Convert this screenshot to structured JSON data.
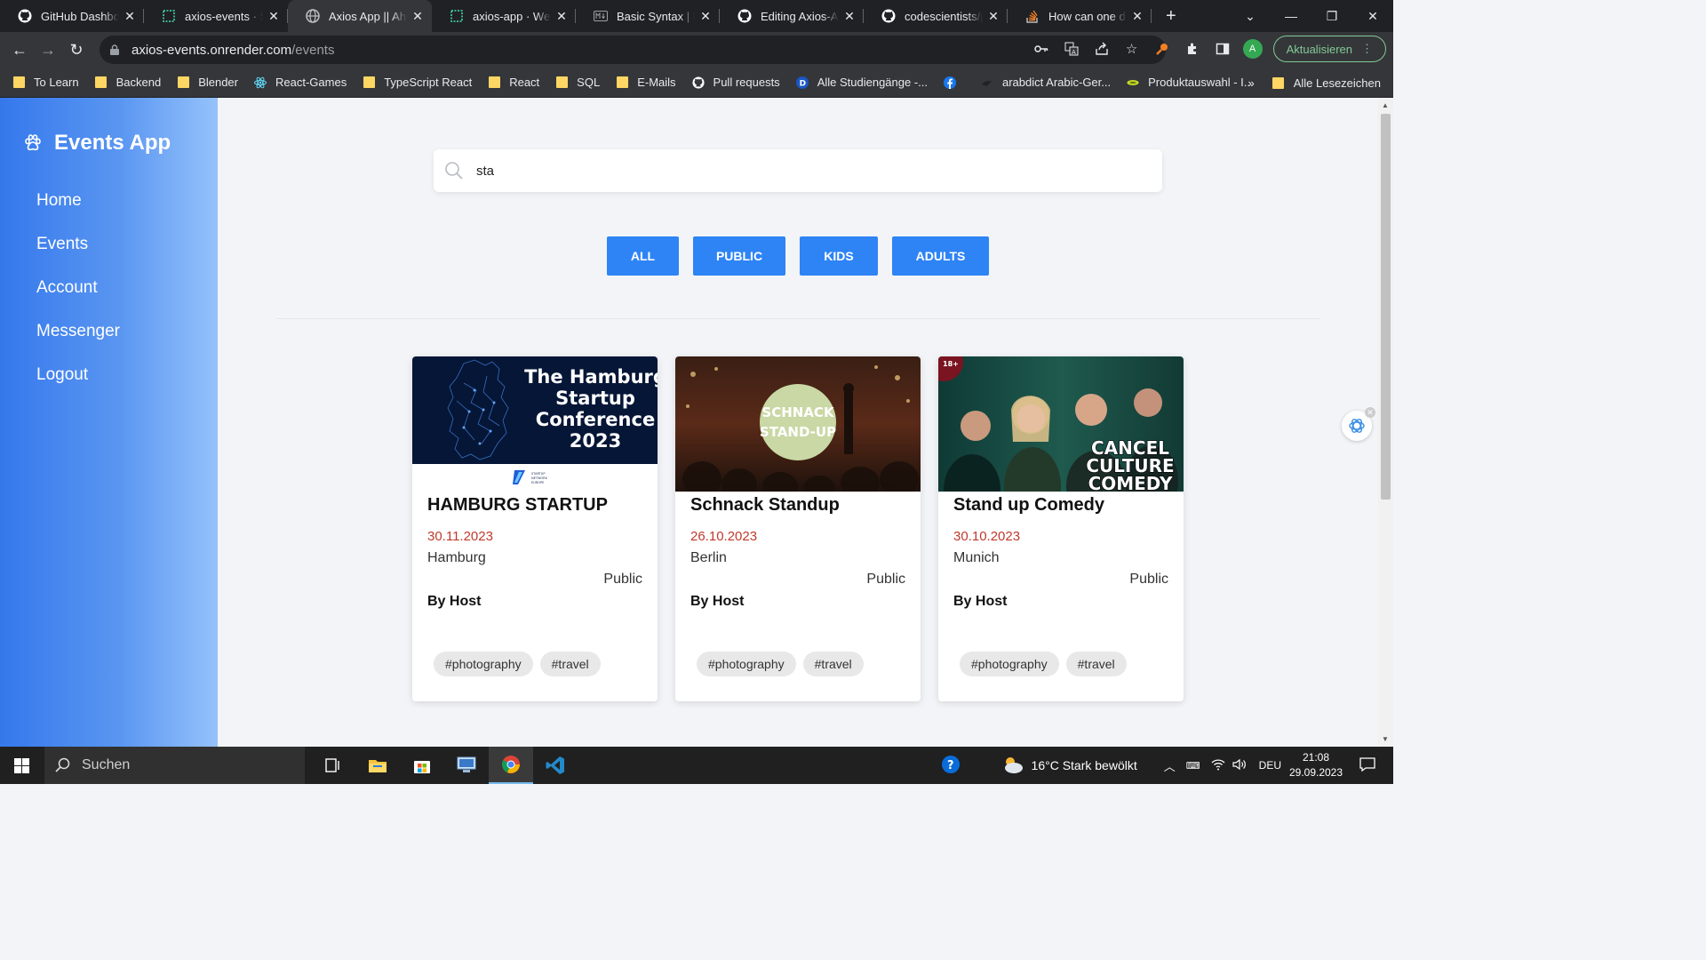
{
  "browser": {
    "tabs": [
      {
        "title": "GitHub Dashboard",
        "icon": "github-icon",
        "active": false
      },
      {
        "title": "axios-events · St",
        "icon": "render-icon",
        "active": false
      },
      {
        "title": "Axios App || Ahm",
        "icon": "globe-icon",
        "active": true
      },
      {
        "title": "axios-app · Web",
        "icon": "render-icon",
        "active": false
      },
      {
        "title": "Basic Syntax | Ma",
        "icon": "markdown-icon",
        "active": false
      },
      {
        "title": "Editing Axios-Ap",
        "icon": "github-icon",
        "active": false
      },
      {
        "title": "codescientists/pi",
        "icon": "github-icon",
        "active": false
      },
      {
        "title": "How can one dis",
        "icon": "stackoverflow-icon",
        "active": false
      }
    ],
    "url_host": "axios-events.onrender.com",
    "url_path": "/events",
    "profile_initial": "A",
    "update_label": "Aktualisieren",
    "bookmarks": [
      {
        "label": "To Learn",
        "icon": "folder-icon"
      },
      {
        "label": "Backend",
        "icon": "folder-icon"
      },
      {
        "label": "Blender",
        "icon": "folder-icon"
      },
      {
        "label": "React-Games",
        "icon": "react-icon"
      },
      {
        "label": "TypeScript React",
        "icon": "folder-icon"
      },
      {
        "label": "React",
        "icon": "folder-icon"
      },
      {
        "label": "SQL",
        "icon": "folder-icon"
      },
      {
        "label": "E-Mails",
        "icon": "folder-icon"
      },
      {
        "label": "Pull requests",
        "icon": "github-icon"
      },
      {
        "label": "Alle Studiengänge -...",
        "icon": "d-icon"
      },
      {
        "label": "",
        "icon": "facebook-icon"
      },
      {
        "label": "arabdict Arabic-Ger...",
        "icon": "arabdict-icon"
      },
      {
        "label": "Produktauswahl - I...",
        "icon": "product-icon"
      }
    ],
    "bookmarks_overflow": "»",
    "all_bookmarks": "Alle Lesezeichen"
  },
  "app": {
    "brand": "Events App",
    "nav": [
      "Home",
      "Events",
      "Account",
      "Messenger",
      "Logout"
    ],
    "search": {
      "value": "sta"
    },
    "filters": [
      "ALL",
      "PUBLIC",
      "KIDS",
      "ADULTS"
    ],
    "events": [
      {
        "title": "HAMBURG STARTUP",
        "date": "30.11.2023",
        "city": "Hamburg",
        "visibility": "Public",
        "host": "By Host",
        "tags": [
          "#photography",
          "#travel"
        ],
        "image_text": [
          "The Hamburg",
          "Startup",
          "Conference",
          "2023"
        ],
        "image_subtext": [
          "STARTUP",
          "NETWORK",
          "EUROPE"
        ]
      },
      {
        "title": "Schnack Standup",
        "date": "26.10.2023",
        "city": "Berlin",
        "visibility": "Public",
        "host": "By Host",
        "tags": [
          "#photography",
          "#travel"
        ],
        "image_text": [
          "SCHNACK",
          "STAND-UP"
        ]
      },
      {
        "title": "Stand up Comedy",
        "date": "30.10.2023",
        "city": "Munich",
        "visibility": "Public",
        "host": "By Host",
        "tags": [
          "#photography",
          "#travel"
        ],
        "image_text": [
          "CANCEL",
          "CULTURE",
          "COMEDY"
        ],
        "image_badge": "18+"
      }
    ]
  },
  "taskbar": {
    "search_label": "Suchen",
    "weather": "16°C  Stark bewölkt",
    "language": "DEU",
    "time": "21:08",
    "date": "29.09.2023"
  },
  "colors": {
    "accent": "#2e84f5",
    "date": "#c0392b",
    "sidebar_start": "#3578ec",
    "sidebar_end": "#95c2fb"
  }
}
